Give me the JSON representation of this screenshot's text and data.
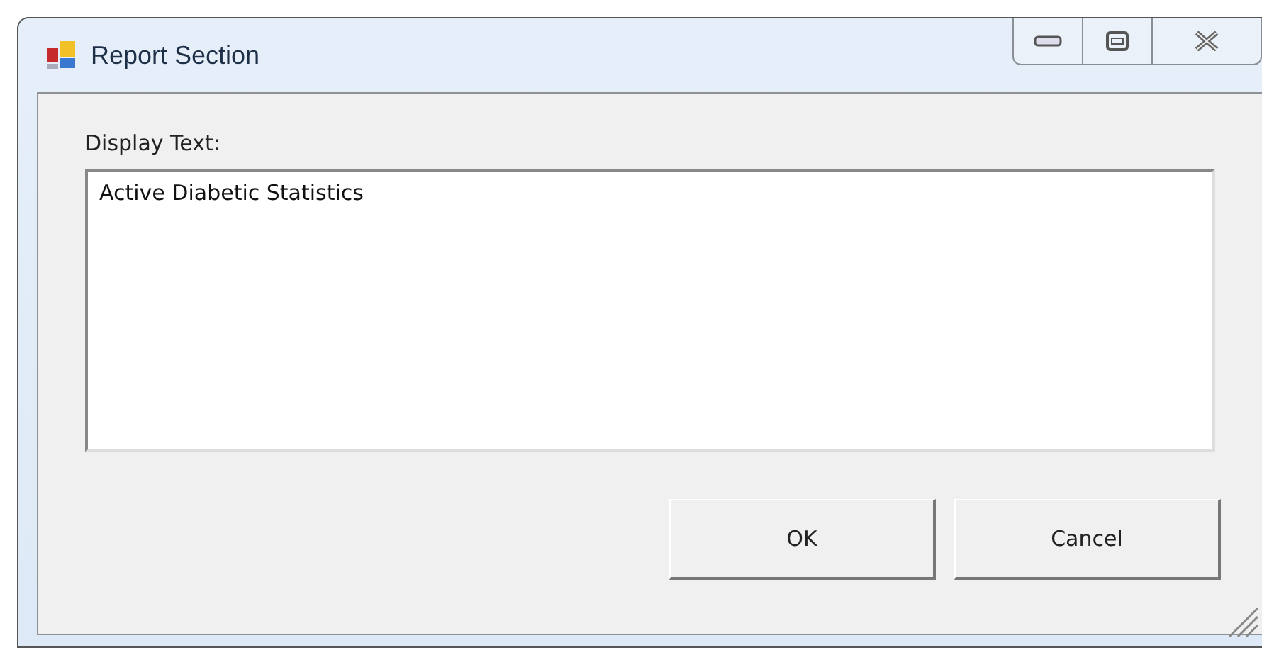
{
  "window": {
    "title": "Report Section"
  },
  "field": {
    "label": "Display Text:",
    "value": "Active Diabetic Statistics"
  },
  "buttons": [
    "OK",
    "Cancel"
  ]
}
